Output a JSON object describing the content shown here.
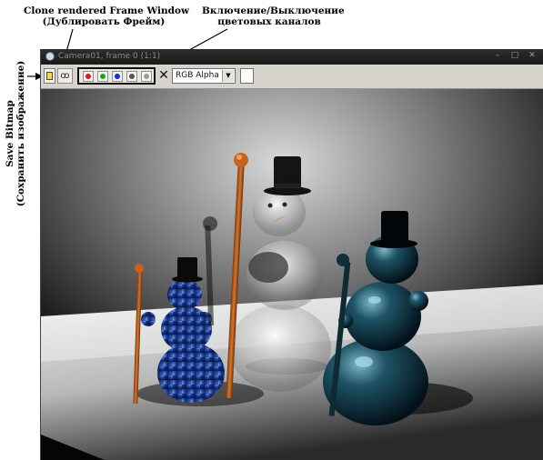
{
  "annotations": {
    "clone_line1": "Clone rendered Frame Window",
    "clone_line2": "(Дублировать Фрейм)",
    "channels_line1": "Включение/Выключение",
    "channels_line2": "цветовых каналов",
    "save_line1": "Save Bitmap",
    "save_line2": "(Сохранить изображение)"
  },
  "window": {
    "title": "Camera01, frame 0 (1:1)",
    "controls": {
      "minimize": "–",
      "maximize": "□",
      "close": "✕"
    }
  },
  "toolbar": {
    "clone_glyph": "ꝏ",
    "clear_glyph": "✕",
    "channel_select_value": "RGB Alpha",
    "channels": [
      {
        "name": "red",
        "color": "#e01818"
      },
      {
        "name": "green",
        "color": "#1aa81a"
      },
      {
        "name": "blue",
        "color": "#1a2fd0"
      },
      {
        "name": "monochrome",
        "color": "#555555"
      },
      {
        "name": "alpha",
        "color": "#9a9a9a"
      }
    ]
  },
  "icons": [
    "save-bitmap-icon",
    "clone-frame-icon",
    "clear-icon",
    "chevron-down-icon"
  ]
}
